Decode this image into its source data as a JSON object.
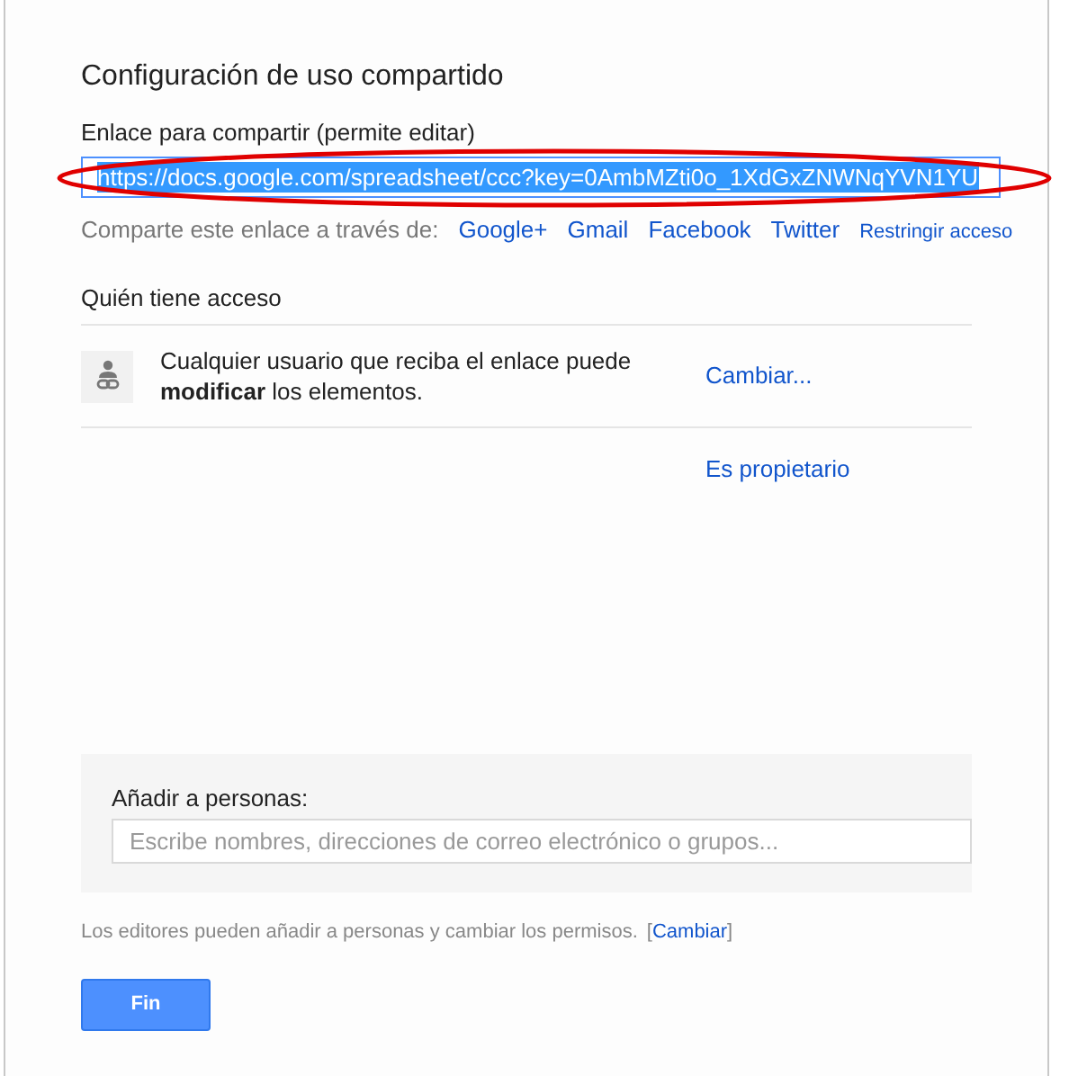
{
  "dialog": {
    "title": "Configuración de uso compartido"
  },
  "share_link": {
    "label": "Enlace para compartir (permite editar)",
    "value": "https://docs.google.com/spreadsheet/ccc?key=0AmbMZti0o_1XdGxZNWNqYVN1YU",
    "selected": true,
    "annotated": true
  },
  "share_via": {
    "label": "Comparte este enlace a través de:",
    "links": [
      "Google+",
      "Gmail",
      "Facebook",
      "Twitter"
    ],
    "restrict": "Restringir acceso"
  },
  "access": {
    "heading": "Quién tiene acceso",
    "entries": [
      {
        "kind": "link",
        "text": "Cualquier usuario que reciba el enlace puede **modificar** los elementos.",
        "action": "Cambiar..."
      },
      {
        "kind": "owner",
        "action": "Es propietario"
      }
    ]
  },
  "add_people": {
    "label": "Añadir a personas:",
    "placeholder": "Escribe nombres, direcciones de correo electrónico o grupos..."
  },
  "note": {
    "text": "Los editores pueden añadir a personas y cambiar los permisos.",
    "open": "[",
    "link": "Cambiar",
    "close": "]"
  },
  "buttons": [
    "Fin"
  ]
}
